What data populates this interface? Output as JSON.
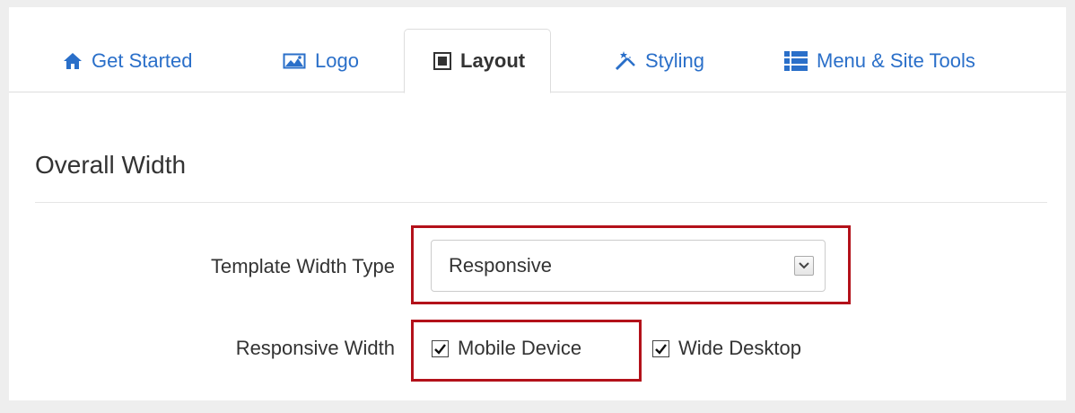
{
  "tabs": [
    {
      "label": "Get Started",
      "icon": "home-icon",
      "active": false
    },
    {
      "label": "Logo",
      "icon": "image-icon",
      "active": false
    },
    {
      "label": "Layout",
      "icon": "layout-icon",
      "active": true
    },
    {
      "label": "Styling",
      "icon": "magic-wand-icon",
      "active": false
    },
    {
      "label": "Menu & Site Tools",
      "icon": "list-icon",
      "active": false
    }
  ],
  "section": {
    "title": "Overall Width"
  },
  "template_width_type": {
    "label": "Template Width Type",
    "value": "Responsive"
  },
  "responsive_width": {
    "label": "Responsive Width",
    "options": [
      {
        "label": "Mobile Device",
        "checked": true
      },
      {
        "label": "Wide Desktop",
        "checked": true
      }
    ]
  },
  "colors": {
    "link": "#2a6fc9",
    "highlight": "#b3111a",
    "background": "#eeeeee"
  }
}
